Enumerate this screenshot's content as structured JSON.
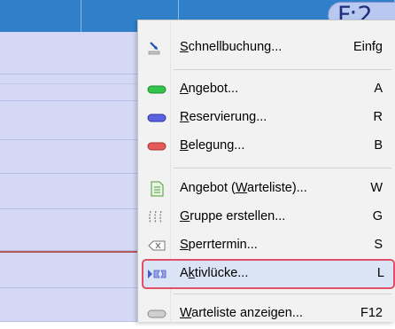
{
  "date_badge": "F:2",
  "menu": {
    "items": [
      {
        "pre": "",
        "u": "S",
        "post": "chnellbuchung...",
        "shortcut": "Einfg",
        "icon": "quick-booking-icon"
      },
      {
        "pre": "",
        "u": "A",
        "post": "ngebot...",
        "shortcut": "A",
        "icon": "green-pill-icon"
      },
      {
        "pre": "",
        "u": "R",
        "post": "eservierung...",
        "shortcut": "R",
        "icon": "blue-pill-icon"
      },
      {
        "pre": "",
        "u": "B",
        "post": "elegung...",
        "shortcut": "B",
        "icon": "red-pill-icon"
      },
      {
        "pre": "Angebot (",
        "u": "W",
        "post": "arteliste)...",
        "shortcut": "W",
        "icon": "document-icon"
      },
      {
        "pre": "",
        "u": "G",
        "post": "ruppe erstellen...",
        "shortcut": "G",
        "icon": "group-bracket-icon"
      },
      {
        "pre": "",
        "u": "S",
        "post": "perrtermin...",
        "shortcut": "S",
        "icon": "block-icon"
      },
      {
        "pre": "A",
        "u": "k",
        "post": "tivlücke...",
        "shortcut": "L",
        "icon": "gap-icon"
      },
      {
        "pre": "",
        "u": "W",
        "post": "arteliste anzeigen...",
        "shortcut": "F12",
        "icon": "gray-pill-icon"
      }
    ]
  },
  "colors": {
    "header": "#2f7fc9",
    "row": "#d4d8f4",
    "menu_bg": "#f2f2f2",
    "highlight_bg": "#dbe4f4",
    "highlight_border": "#e05068"
  }
}
